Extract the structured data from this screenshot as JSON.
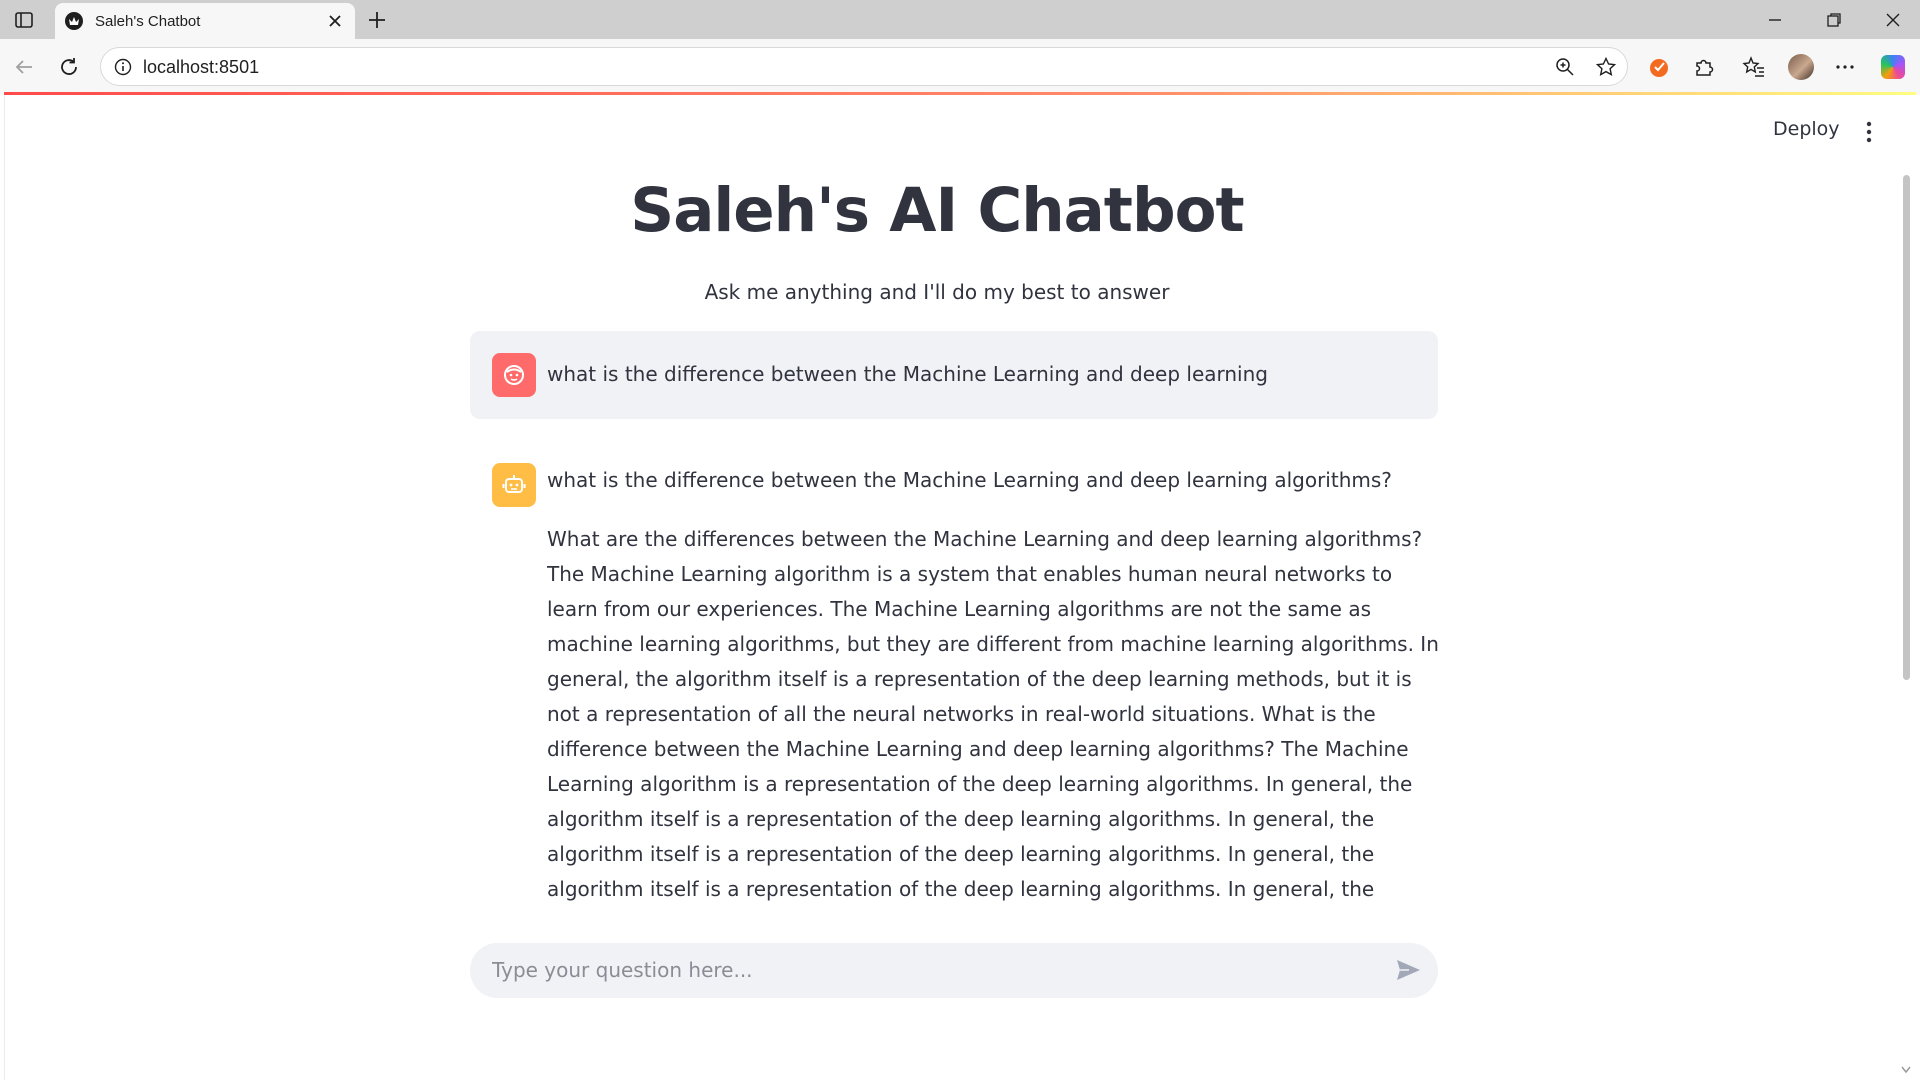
{
  "browser": {
    "tab_title": "Saleh's Chatbot",
    "url": "localhost:8501"
  },
  "header": {
    "deploy_label": "Deploy"
  },
  "main": {
    "title": "Saleh's AI Chatbot",
    "subtitle": "Ask me anything and I'll do my best to answer"
  },
  "messages": {
    "user": "what is the difference between the Machine Learning and deep learning",
    "assistant_question": "what is the difference between the Machine Learning and deep learning algorithms?",
    "assistant_answer": "What are the differences between the Machine Learning and deep learning algorithms? The Machine Learning algorithm is a system that enables human neural networks to learn from our experiences. The Machine Learning algorithms are not the same as machine learning algorithms, but they are different from machine learning algorithms. In general, the algorithm itself is a representation of the deep learning methods, but it is not a representation of all the neural networks in real-world situations. What is the difference between the Machine Learning and deep learning algorithms? The Machine Learning algorithm is a representation of the deep learning algorithms. In general, the algorithm itself is a representation of the deep learning algorithms. In general, the algorithm itself is a representation of the deep learning algorithms. In general, the algorithm itself is a representation of the deep learning algorithms. In general, the algorithm itself is a representation of the deep learning algorithms. In general, the algorithm itself is a representation of the deep learning algorithms. In general, the algorithm itself is a representation"
  },
  "chat_input": {
    "placeholder": "Type your question here...",
    "value": ""
  },
  "colors": {
    "user_avatar": "#ff6b6b",
    "bot_avatar": "#ffbd45",
    "message_bg": "#f0f2f6",
    "text": "#31333f"
  },
  "icons": {
    "user_avatar": "smiley-face-icon",
    "bot_avatar": "robot-icon",
    "send": "send-icon",
    "menu": "vertical-dots-icon"
  }
}
